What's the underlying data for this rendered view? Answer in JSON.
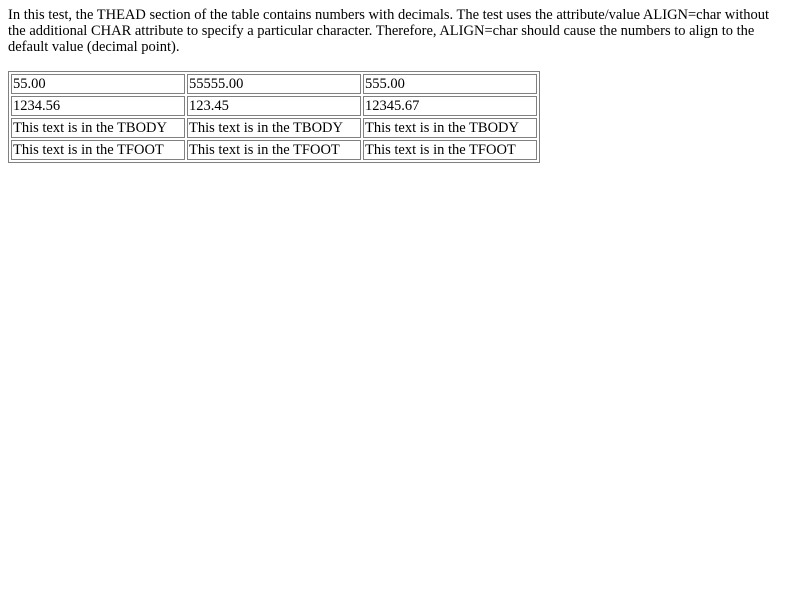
{
  "intro_text": "In this test, the THEAD section of the table contains numbers with decimals. The test uses the attribute/value ALIGN=char without the additional CHAR attribute to specify a particular character. Therefore, ALIGN=char should cause the numbers to align to the default value (decimal point).",
  "table": {
    "thead": [
      [
        "55.00",
        "55555.00",
        "555.00"
      ],
      [
        "1234.56",
        "123.45",
        "12345.67"
      ]
    ],
    "tbody": [
      [
        "This text is in the TBODY",
        "This text is in the TBODY",
        "This text is in the TBODY"
      ]
    ],
    "tfoot": [
      [
        "This text is in the TFOOT",
        "This text is in the TFOOT",
        "This text is in the TFOOT"
      ]
    ]
  }
}
